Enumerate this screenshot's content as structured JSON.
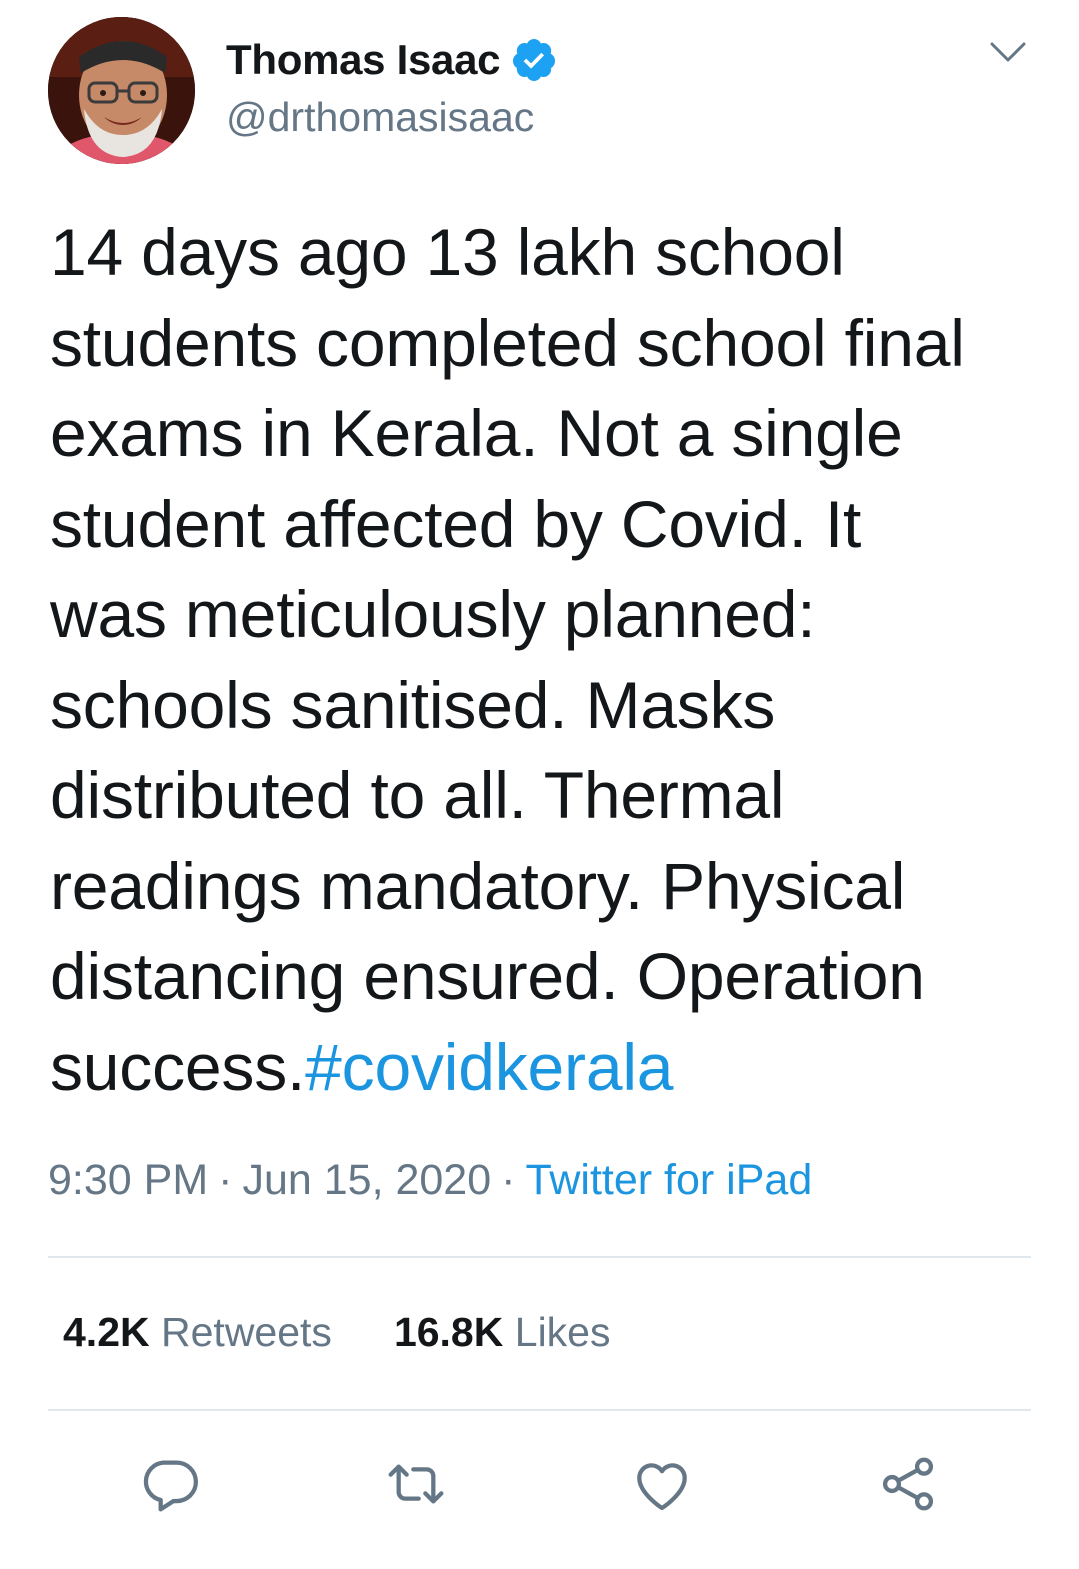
{
  "tweet": {
    "author": {
      "display_name": "Thomas Isaac",
      "handle": "@drthomasisaac",
      "verified": true,
      "avatar_icon": "profile-photo"
    },
    "text_lines": [
      "14  days ago 13 lakh school",
      "students completed school final",
      "exams in Kerala. Not a single",
      "student affected by Covid. It",
      "was meticulously planned:",
      "schools sanitised. Masks",
      "distributed to all. Thermal",
      "readings mandatory. Physical",
      "distancing ensured. Operation"
    ],
    "last_line_text": "success.",
    "hashtag": "#covidkerala",
    "time": "9:30 PM",
    "date": "Jun 15, 2020",
    "separator": "·",
    "source": "Twitter for iPad",
    "retweets_count": "4.2K",
    "retweets_label": "Retweets",
    "likes_count": "16.8K",
    "likes_label": "Likes"
  },
  "icons": {
    "caret": "chevron-down-icon",
    "verified": "verified-badge-icon",
    "reply": "reply-icon",
    "retweet": "retweet-icon",
    "like": "heart-icon",
    "share": "share-icon"
  },
  "colors": {
    "text": "#14171a",
    "secondary": "#657786",
    "link": "#1b95e0",
    "verified": "#1da1f2",
    "divider": "#e1e8ed"
  }
}
